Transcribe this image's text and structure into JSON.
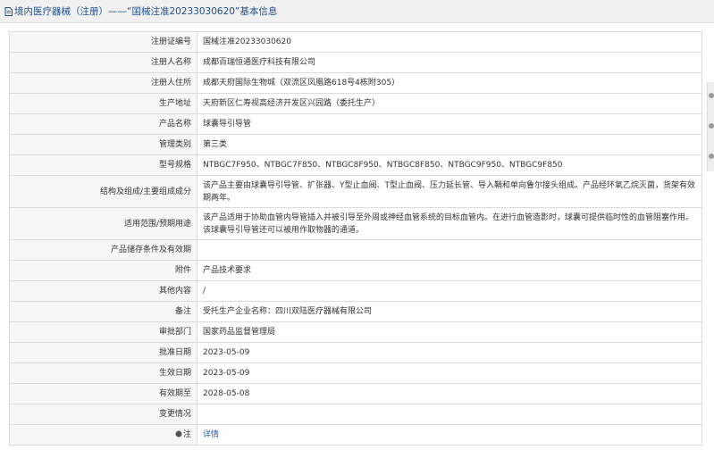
{
  "header": {
    "title": "境内医疗器械（注册）——“国械注准20233030620”基本信息",
    "icon": "document-icon"
  },
  "rows": [
    {
      "label": "注册证编号",
      "value": "国械注准20233030620"
    },
    {
      "label": "注册人名称",
      "value": "成都百瑞恒通医疗科技有限公司"
    },
    {
      "label": "注册人住所",
      "value": "成都天府国际生物城（双流区凤凰路618号4栋附305）"
    },
    {
      "label": "生产地址",
      "value": "天府新区仁寿视高经济开发区兴园路（委托生产）"
    },
    {
      "label": "产品名称",
      "value": "球囊导引导管"
    },
    {
      "label": "管理类别",
      "value": "第三类"
    },
    {
      "label": "型号规格",
      "value": "NTBGC7F950、NTBGC7F850、NTBGC8F950、NTBGC8F850、NTBGC9F950、NTBGC9F850"
    },
    {
      "label": "结构及组成/主要组成成分",
      "value": "该产品主要由球囊导引导管、扩张器、Y型止血阀、T型止血阀、压力延长管、导入鞘和单向鲁尔接头组成。产品经环氧乙烷灭菌，货架有效期两年。"
    },
    {
      "label": "适用范围/预期用途",
      "value": "该产品适用于协助血管内导管插入并被引导至外周或神经血管系统的目标血管内。在进行血管造影时，球囊可提供临时性的血管阻塞作用。该球囊导引导管还可以被用作取物器的通道。"
    },
    {
      "label": "产品储存条件及有效期",
      "value": ""
    },
    {
      "label": "附件",
      "value": "产品技术要求"
    },
    {
      "label": "其他内容",
      "value": "/"
    },
    {
      "label": "备注",
      "value": "受托生产企业名称：四川双陆医疗器械有限公司"
    },
    {
      "label": "审批部门",
      "value": "国家药品监督管理局"
    },
    {
      "label": "批准日期",
      "value": "2023-05-09"
    },
    {
      "label": "生效日期",
      "value": "2023-05-09"
    },
    {
      "label": "有效期至",
      "value": "2028-05-08"
    },
    {
      "label": "变更情况",
      "value": ""
    }
  ],
  "note_row": {
    "label": "注",
    "link": "详情",
    "icon": "note-icon"
  },
  "colors": {
    "title": "#1f4e8c",
    "link": "#1f5fa8",
    "border": "#dcdcdc",
    "label_bg": "#f7f7f7"
  }
}
